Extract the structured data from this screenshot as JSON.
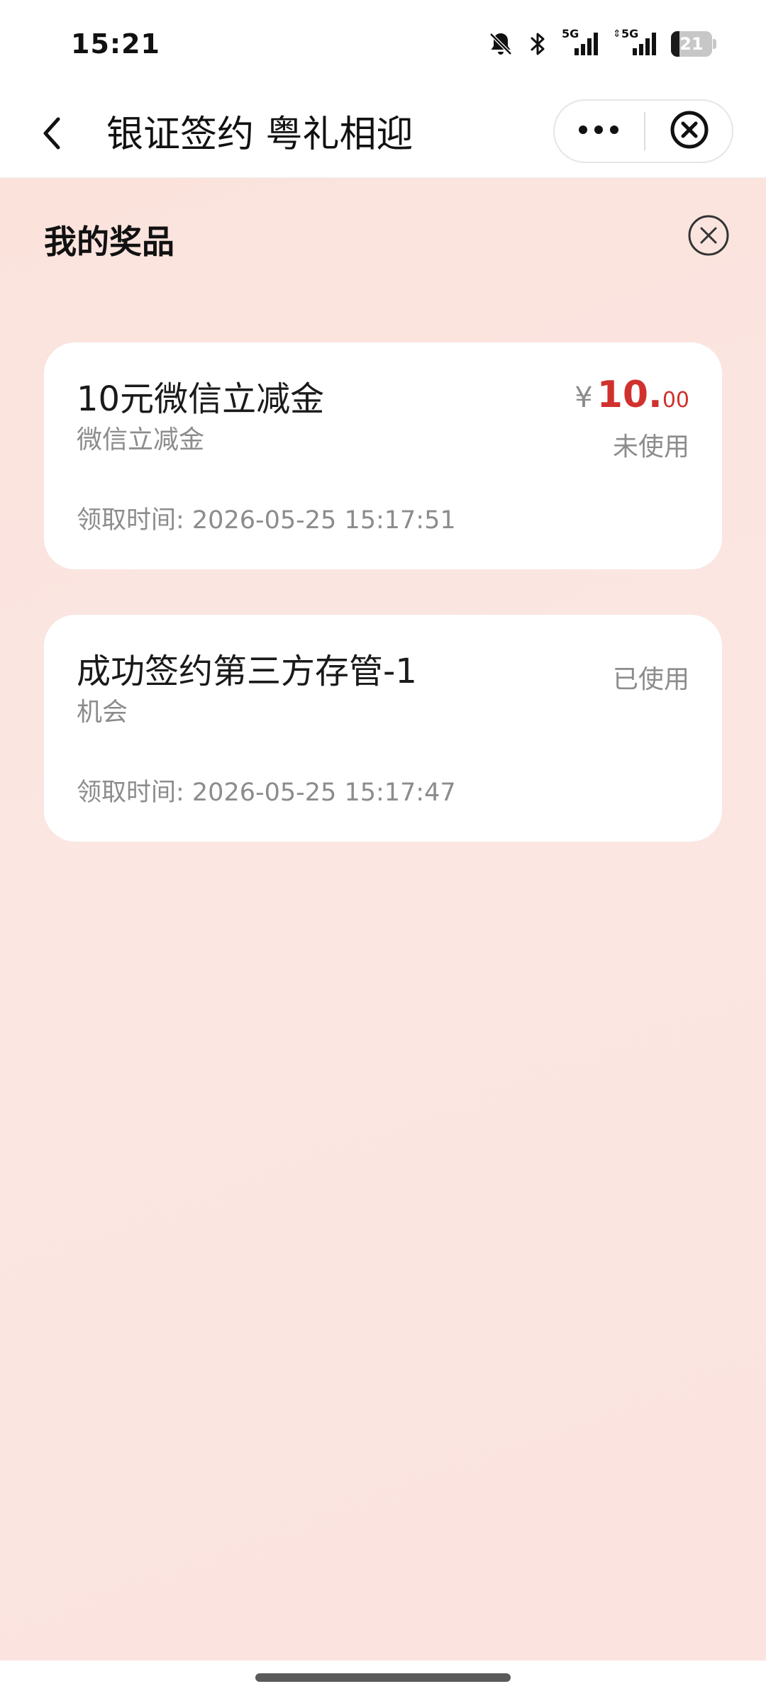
{
  "status_bar": {
    "time": "15:21",
    "icons": [
      "bell-muted-icon",
      "bluetooth-icon",
      "signal-5g-icon",
      "signal-5g-icon"
    ],
    "network_1": "5G",
    "network_2": "5G",
    "battery_level": "21"
  },
  "title_bar": {
    "title": "银证签约 粤礼相迎",
    "back_icon": "chevron-left-icon",
    "more_icon": "more-dots-icon",
    "close_icon": "close-circle-icon"
  },
  "panel": {
    "title": "我的奖品",
    "close_icon": "close-circle-icon"
  },
  "prizes": [
    {
      "name": "10元微信立减金",
      "subtitle": "微信立减金",
      "currency": "¥",
      "price_int": "10.",
      "price_dec": "00",
      "status": "未使用",
      "claim_time": "领取时间: 2026-05-25 15:17:51"
    },
    {
      "name": "成功签约第三方存管-1",
      "subtitle": "机会",
      "status": "已使用",
      "claim_time": "领取时间: 2026-05-25 15:17:47"
    }
  ],
  "colors": {
    "accent_red": "#d0312d",
    "background": "#fbe4df",
    "muted_text": "#8c8c8c"
  }
}
